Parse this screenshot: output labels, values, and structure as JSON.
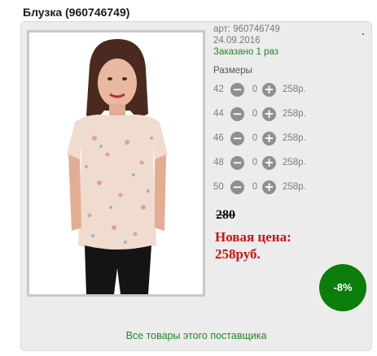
{
  "product": {
    "title": "Блузка (960746749)",
    "article": "арт: 960746749",
    "date": "24.09.2016",
    "ordered": "Заказано 1 раз"
  },
  "sizes": {
    "label": "Размеры",
    "rows": [
      {
        "size": "42",
        "qty": "0",
        "price": "258р."
      },
      {
        "size": "44",
        "qty": "0",
        "price": "258р."
      },
      {
        "size": "46",
        "qty": "0",
        "price": "258р."
      },
      {
        "size": "48",
        "qty": "0",
        "price": "258р."
      },
      {
        "size": "50",
        "qty": "0",
        "price": "258р."
      }
    ]
  },
  "pricing": {
    "old_price": "280",
    "new_price_line1": "Новая цена:",
    "new_price_line2": "258руб.",
    "discount": "-8%"
  },
  "footer": {
    "supplier_link": "Все товары этого поставщика"
  },
  "colors": {
    "accent_green": "#1f8a1f",
    "discount_badge": "#0a7d0a",
    "new_price_red": "#d11111"
  },
  "icons": {
    "minus": "minus-circle-icon",
    "plus": "plus-circle-icon"
  }
}
